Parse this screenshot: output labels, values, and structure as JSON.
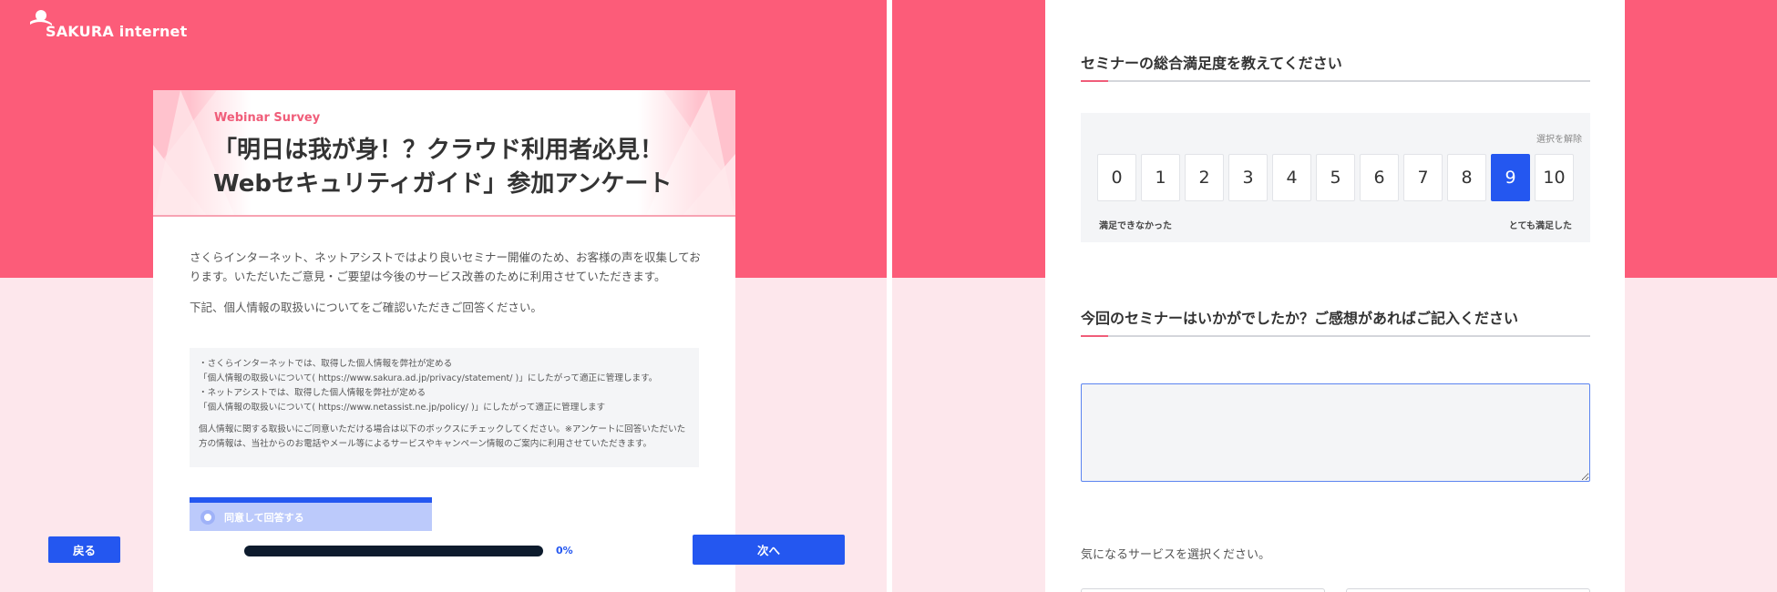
{
  "brand": {
    "logo_text": "SAKURA internet",
    "primary_color": "#fc5c79",
    "accent_blue": "#2457f0"
  },
  "survey": {
    "kicker": "Webinar Survey",
    "title_line1": "「明日は我が身！？クラウド利用者必見！",
    "title_line2": "Webセキュリティガイド」参加アンケート",
    "intro_p1": "さくらインターネット、ネットアシストではより良いセミナー開催のため、お客様の声を収集しております。いただいたご意見・ご要望は今後のサービス改善のために利用させていただきます。",
    "intro_p2": "下記、個人情報の取扱いについてをご確認いただきご回答ください。",
    "privacy": {
      "line1": "・さくらインターネットでは、取得した個人情報を弊社が定める",
      "line2": "「個人情報の取扱いについて( https://www.sakura.ad.jp/privacy/statement/ )」にしたがって適正に管理します。",
      "line3": "・ネットアシストでは、取得した個人情報を弊社が定める",
      "line4": "「個人情報の取扱いについて( https://www.netassist.ne.jp/policy/ )」にしたがって適正に管理します",
      "line5": "個人情報に関する取扱いにご同意いただける場合は以下のボックスにチェックしてください。※アンケートに回答いただいた方の情報は、当社からのお電話やメール等によるサービスやキャンペーン情報のご案内に利用させていただきます。"
    },
    "consent_label": "同意して回答する"
  },
  "nav": {
    "back_label": "戻る",
    "next_label": "次へ",
    "progress_label": "0%",
    "progress_fraction": 0
  },
  "q1": {
    "title": "セミナーの総合満足度を教えてください",
    "clear_label": "選択を解除",
    "options": [
      "0",
      "1",
      "2",
      "3",
      "4",
      "5",
      "6",
      "7",
      "8",
      "9",
      "10"
    ],
    "selected": "9",
    "low_label": "満足できなかった",
    "high_label": "とても満足した"
  },
  "q2": {
    "title": "今回のセミナーはいかがでしたか？ご感想があればご記入ください",
    "value": ""
  },
  "q3": {
    "prompt": "気になるサービスを選択ください。"
  }
}
